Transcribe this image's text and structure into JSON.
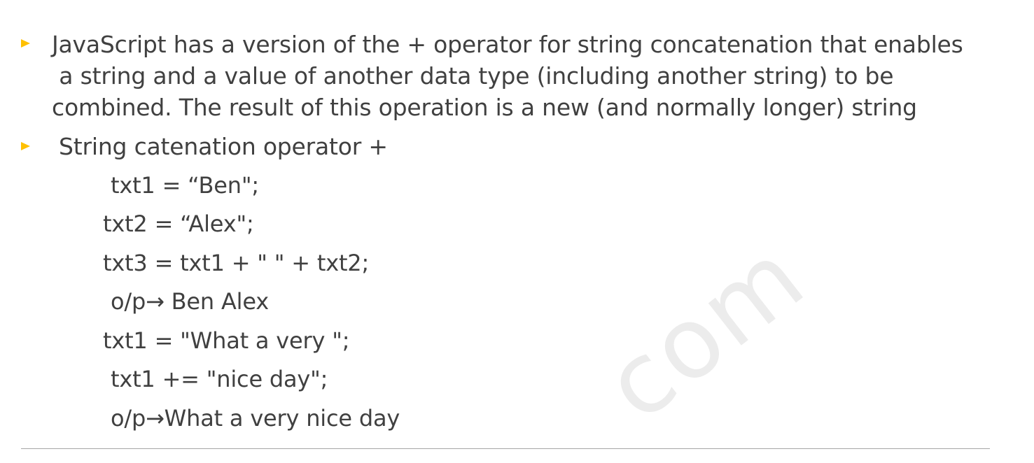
{
  "bullets": [
    {
      "lines": [
        "JavaScript has a version of the + operator for string concatenation that enables",
        " a string and a value of another data type (including another string) to be",
        "combined. The result of this operation is a new (and normally longer) string"
      ]
    },
    {
      "lines": [
        "String catenation operator +"
      ]
    }
  ],
  "code": [
    "txt1 = “Ben\";",
    "txt2 = “Alex\";",
    "txt3 = txt1 + \" \" + txt2;",
    "o/p→ Ben Alex",
    "txt1 = \"What a very \";",
    "txt1 += \"nice day\";",
    "o/p→What a very nice day"
  ],
  "watermark": "com",
  "colors": {
    "bullet": "#ffc000",
    "text": "#404040",
    "divider": "#a6a6a6"
  }
}
